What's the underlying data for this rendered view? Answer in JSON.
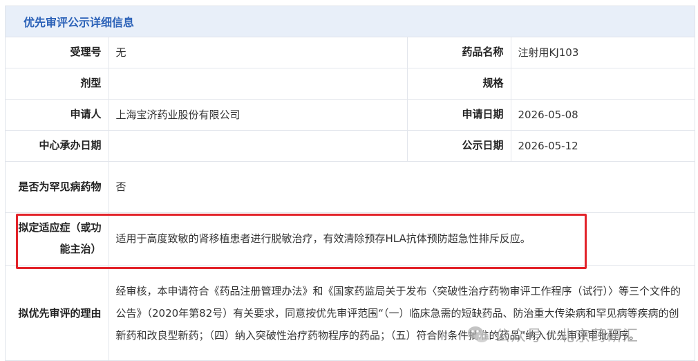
{
  "panel": {
    "title": "优先审评公示详细信息"
  },
  "rows": {
    "acceptance_no": {
      "label": "受理号",
      "value": "无"
    },
    "drug_name": {
      "label": "药品名称",
      "value": "注射用KJ103"
    },
    "dosage_form": {
      "label": "剂型",
      "value": ""
    },
    "specification": {
      "label": "规格",
      "value": ""
    },
    "applicant": {
      "label": "申请人",
      "value": "上海宝济药业股份有限公司"
    },
    "application_date": {
      "label": "申请日期",
      "value": "2026-05-08"
    },
    "center_date": {
      "label": "中心承办日期",
      "value": ""
    },
    "publicity_date": {
      "label": "公示日期",
      "value": "2026-05-12"
    },
    "rare_disease": {
      "label": "是否为罕见病药物",
      "value": "否"
    },
    "indication": {
      "label": "拟定适应症（或功能主治）",
      "value": "适用于高度致敏的肾移植患者进行脱敏治疗，有效清除预存HLA抗体预防超急性排斥反应。"
    },
    "reason": {
      "label": "拟优先审评的理由",
      "value": "经审核，本申请符合《药品注册管理办法》和《国家药监局关于发布〈突破性治疗药物审评工作程序（试行）〉等三个文件的公告》（2020年第82号）有关要求，同意按优先审评范围“（一）临床急需的短缺药品、防治重大传染病和罕见病等疾病的创新药和改良型新药；（四）纳入突破性治疗药物程序的药品；（五）符合附条件批准的药品”纳入优先审评审批程序。"
    }
  },
  "watermark": {
    "text": "公众号 · 北京药研汇",
    "icon": "wechat-logo-icon"
  },
  "colors": {
    "header_bg": "#e8eff9",
    "header_text": "#2c62b8",
    "highlight": "#e2232a"
  }
}
